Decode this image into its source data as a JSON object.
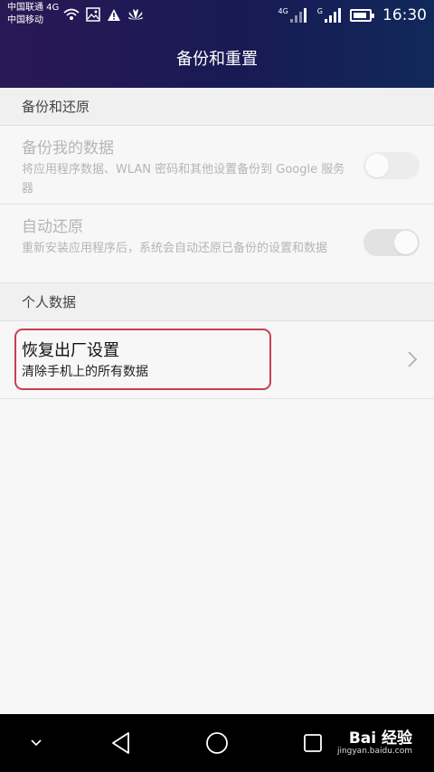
{
  "status_bar": {
    "carrier1": "中国联通 4G",
    "carrier2": "中国移动",
    "network1": "4G",
    "network2": "G",
    "time": "16:30"
  },
  "header": {
    "title": "备份和重置"
  },
  "sections": {
    "backup_restore": {
      "label": "备份和还原"
    },
    "personal_data": {
      "label": "个人数据"
    }
  },
  "rows": {
    "backup_data": {
      "title": "备份我的数据",
      "subtitle": "将应用程序数据、WLAN 密码和其他设置备份到 Google 服务器",
      "toggle_on": false
    },
    "auto_restore": {
      "title": "自动还原",
      "subtitle": "重新安装应用程序后，系统会自动还原已备份的设置和数据",
      "toggle_on": true
    },
    "factory_reset": {
      "title": "恢复出厂设置",
      "subtitle": "清除手机上的所有数据"
    }
  },
  "watermark": {
    "main": "Bai 经验",
    "sub": "jingyan.baidu.com"
  },
  "colors": {
    "header_bg": "#1a1a55",
    "highlight_border": "#c8404f",
    "disabled_text": "#b5b5b5"
  }
}
